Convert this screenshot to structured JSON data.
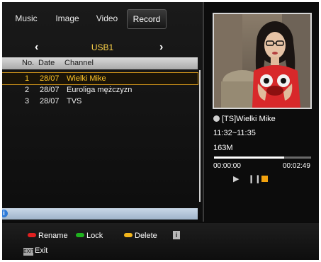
{
  "tabs": [
    {
      "label": "Music",
      "active": false
    },
    {
      "label": "Image",
      "active": false
    },
    {
      "label": "Video",
      "active": false
    },
    {
      "label": "Record",
      "active": true
    }
  ],
  "device": {
    "label": "USB1",
    "prev_icon": "chevron-left-icon",
    "next_icon": "chevron-right-icon"
  },
  "columns": {
    "no": "No.",
    "date": "Date",
    "channel": "Channel"
  },
  "recordings": [
    {
      "no": "1",
      "date": "28/07",
      "channel": "Wielki Mike",
      "selected": true
    },
    {
      "no": "2",
      "date": "28/07",
      "channel": "Euroliga mężczyzn",
      "selected": false
    },
    {
      "no": "3",
      "date": "28/07",
      "channel": "TVS",
      "selected": false
    }
  ],
  "details": {
    "title": "[TS]Wielki Mike",
    "time_range": "11:32~11:35",
    "size": "163M",
    "elapsed": "00:00:00",
    "duration": "00:02:49",
    "progress": 0.72
  },
  "footer": {
    "rename": "Rename",
    "lock": "Lock",
    "delete": "Delete",
    "info": "i",
    "exit_key": "EXIT",
    "exit": "Exit"
  },
  "colors": {
    "accent": "#ffc629",
    "red": "#e02020",
    "green": "#1fb21f",
    "yellow": "#f2b51b"
  }
}
